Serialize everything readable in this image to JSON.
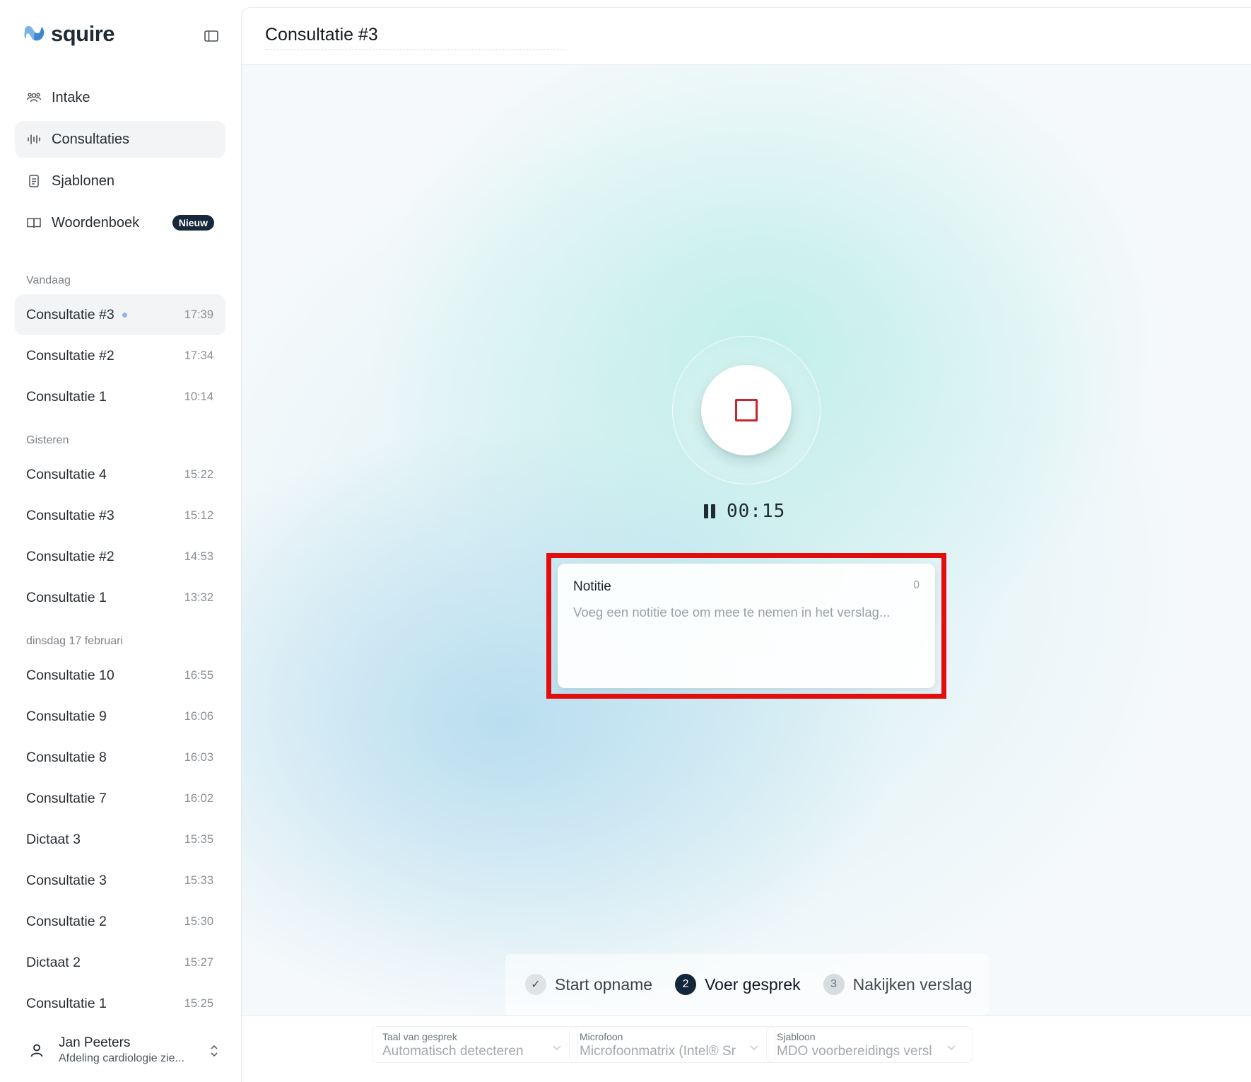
{
  "app": {
    "brand": "squire",
    "icons": {
      "logo": "squire-logo-icon",
      "collapse": "sidebar-collapse-icon"
    }
  },
  "nav": [
    {
      "label": "Intake",
      "icon": "users-icon"
    },
    {
      "label": "Consultaties",
      "icon": "waveform-icon",
      "active": true
    },
    {
      "label": "Sjablonen",
      "icon": "document-icon"
    },
    {
      "label": "Woordenboek",
      "icon": "book-icon",
      "badge": "Nieuw"
    }
  ],
  "history": {
    "groups": [
      {
        "label": "Vandaag",
        "items": [
          {
            "title": "Consultatie #3",
            "time": "17:39"
          },
          {
            "title": "Consultatie #2",
            "time": "17:34"
          },
          {
            "title": "Consultatie 1",
            "time": "10:14"
          }
        ]
      },
      {
        "label": "Gisteren",
        "items": [
          {
            "title": "Consultatie 4",
            "time": "15:22"
          },
          {
            "title": "Consultatie #3",
            "time": "15:12"
          },
          {
            "title": "Consultatie #2",
            "time": "14:53"
          },
          {
            "title": "Consultatie 1",
            "time": "13:32"
          }
        ]
      },
      {
        "label": "dinsdag 17 februari",
        "items": [
          {
            "title": "Consultatie 10",
            "time": "16:55"
          },
          {
            "title": "Consultatie 9",
            "time": "16:06"
          },
          {
            "title": "Consultatie 8",
            "time": "16:03"
          },
          {
            "title": "Consultatie 7",
            "time": "16:02"
          },
          {
            "title": "Dictaat 3",
            "time": "15:35"
          },
          {
            "title": "Consultatie 3",
            "time": "15:33"
          },
          {
            "title": "Consultatie 2",
            "time": "15:30"
          },
          {
            "title": "Dictaat 2",
            "time": "15:27"
          },
          {
            "title": "Consultatie 1",
            "time": "15:25"
          }
        ]
      }
    ]
  },
  "user": {
    "name": "Jan Peeters",
    "department": "Afdeling cardiologie zie..."
  },
  "page": {
    "title": "Consultatie #3"
  },
  "recorder": {
    "timer": "00:15",
    "stop_color": "#c8262c"
  },
  "note": {
    "title": "Notitie",
    "count": "0",
    "placeholder": "Voeg een notitie toe om mee te nemen in het verslag...",
    "highlight_color": "#e40d0d"
  },
  "steps": [
    {
      "label": "Start opname",
      "marker": "✓",
      "state": "done"
    },
    {
      "label": "Voer gesprek",
      "marker": "2",
      "state": "current"
    },
    {
      "label": "Nakijken verslag",
      "marker": "3",
      "state": "todo"
    }
  ],
  "settings": {
    "language": {
      "caption": "Taal van gesprek",
      "value": "Automatisch detecteren"
    },
    "microphone": {
      "caption": "Microfoon",
      "value": "Microfoonmatrix (Intel® Sr"
    },
    "template": {
      "caption": "Sjabloon",
      "value": "MDO voorbereidings versl"
    }
  }
}
